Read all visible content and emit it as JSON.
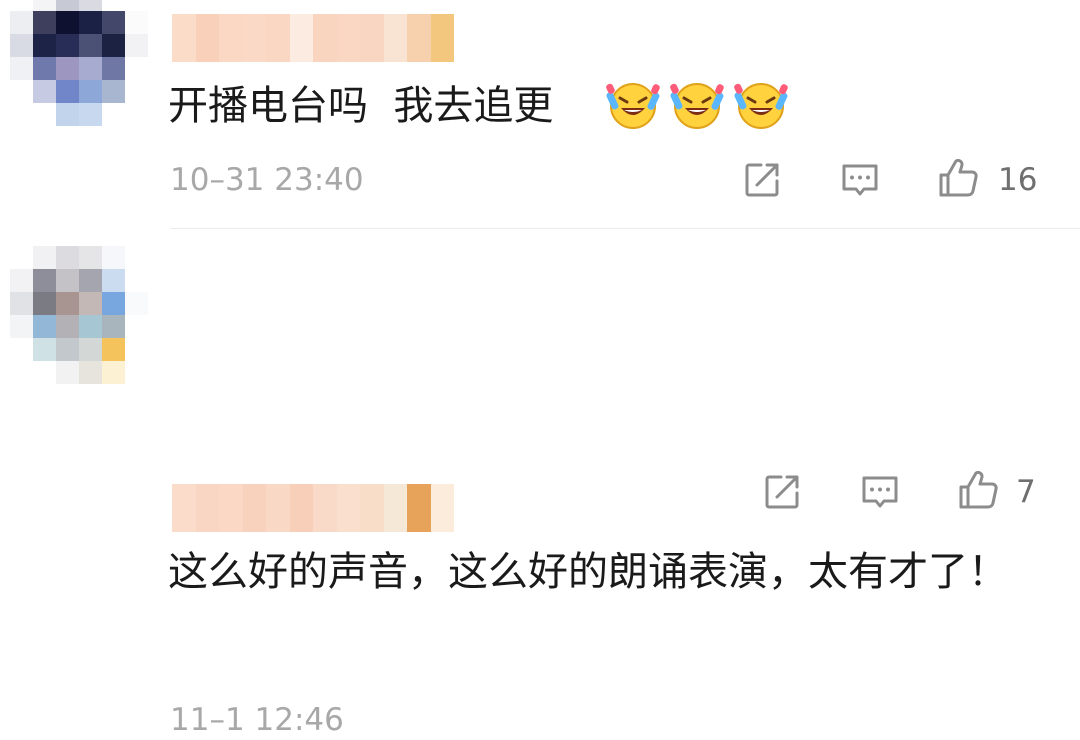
{
  "comments": [
    {
      "text": "开播电台吗  我去追更",
      "emoji": [
        "grinning-tears-icon",
        "grinning-tears-icon",
        "grinning-tears-icon"
      ],
      "timestamp": "10–31 23:40",
      "likes": "16"
    },
    {
      "text": "这么好的声音，这么好的朗诵表演，太有才了！",
      "emoji": [],
      "timestamp": "11–1 12:46",
      "likes": "7"
    }
  ],
  "icons": {
    "share": "share-icon",
    "reply": "reply-icon",
    "like": "thumbs-up-icon"
  },
  "colors": {
    "text": "#1a1a1a",
    "meta": "#a8a8a8",
    "icon": "#8c8c8c"
  }
}
